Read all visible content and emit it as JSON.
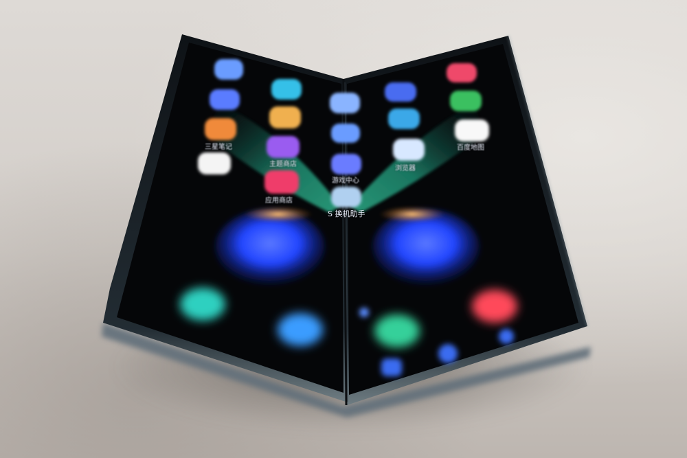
{
  "left_panel_apps": [
    {
      "name": "app-1",
      "label": ""
    },
    {
      "name": "app-2",
      "label": ""
    },
    {
      "name": "app-3",
      "label": ""
    },
    {
      "name": "samsung-notes",
      "label": "三星笔记"
    },
    {
      "name": "theme-store",
      "label": "主题商店"
    },
    {
      "name": "app-store",
      "label": "应用商店"
    },
    {
      "name": "app-7",
      "label": ""
    }
  ],
  "center_apps": [
    {
      "name": "game-center",
      "label": "游戏中心"
    },
    {
      "name": "smart-switch",
      "label": "S 换机助手"
    }
  ],
  "right_panel_apps": [
    {
      "name": "browser",
      "label": "浏览器"
    },
    {
      "name": "baidu-maps",
      "label": "百度地图"
    }
  ],
  "colors": {
    "wallpaper_wing": "#1a3cff",
    "wallpaper_glow": "#e8a040",
    "wallpaper_leaf": "#1f8a6a",
    "screen_bg": "#050608",
    "frame": "#1e2a33"
  }
}
